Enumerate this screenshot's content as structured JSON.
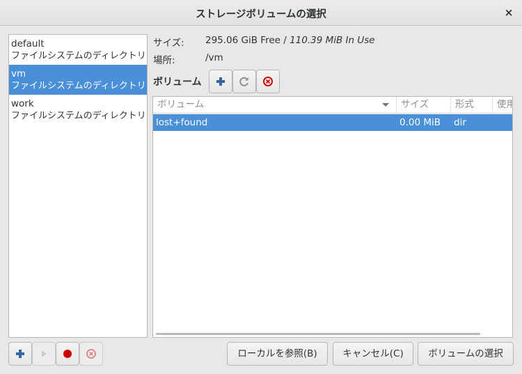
{
  "window": {
    "title": "ストレージボリュームの選択",
    "close_glyph": "×"
  },
  "pools": [
    {
      "name": "default",
      "desc": "ファイルシステムのディレクトリー"
    },
    {
      "name": "vm",
      "desc": "ファイルシステムのディレクトリー",
      "selected": true
    },
    {
      "name": "work",
      "desc": "ファイルシステムのディレクトリー"
    }
  ],
  "info": {
    "size_label": "サイズ:",
    "size_free": "295.06 GiB Free / ",
    "size_used": "110.39 MiB In Use",
    "location_label": "場所:",
    "location_value": "/vm"
  },
  "volumes": {
    "heading": "ボリューム",
    "columns": [
      "ボリューム",
      "サイズ",
      "形式",
      "使用"
    ],
    "rows": [
      {
        "name": "lost+found",
        "size": "0.00 MiB",
        "format": "dir",
        "used": ""
      }
    ]
  },
  "buttons": {
    "browse_local": "ローカルを参照(B)",
    "cancel": "キャンセル(C)",
    "choose_volume": "ボリュームの選択"
  },
  "colors": {
    "selection": "#4a90d9",
    "add": "#3465a4",
    "stop": "#cc0000"
  }
}
